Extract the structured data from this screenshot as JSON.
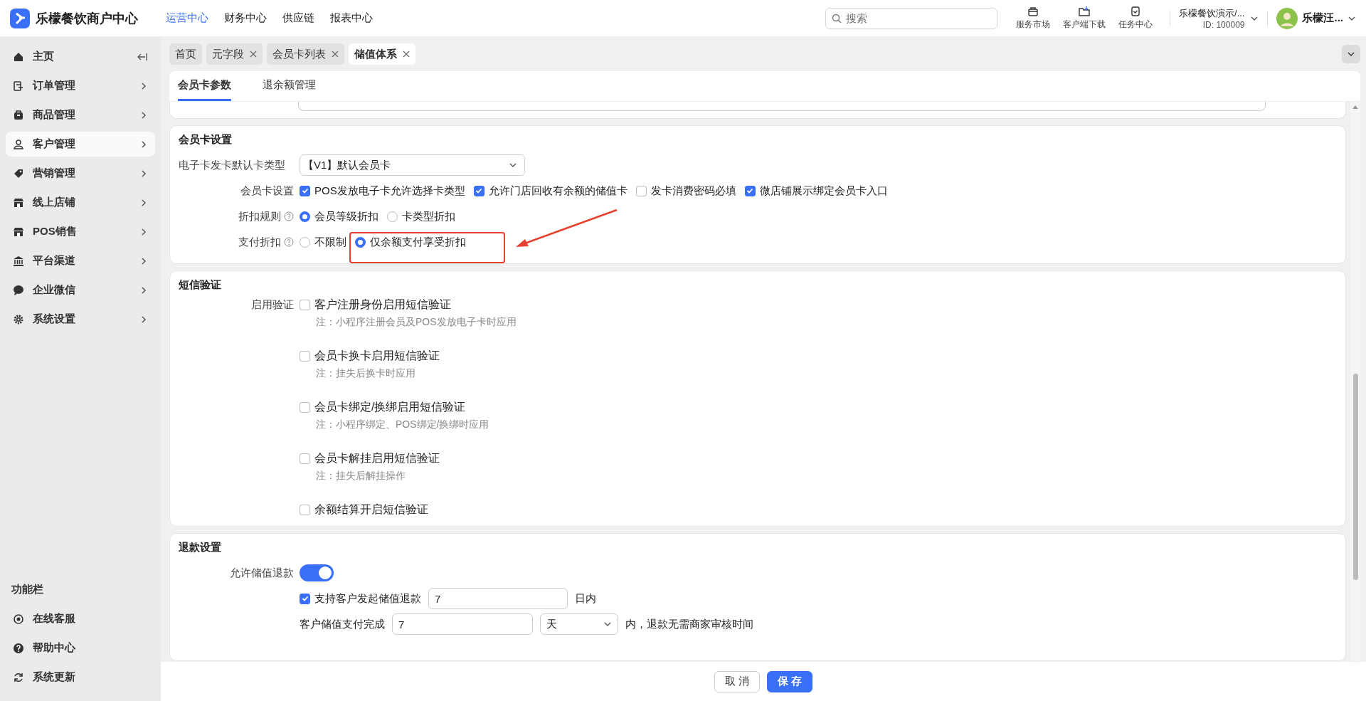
{
  "logo": {
    "name": "乐檬餐饮商户中心"
  },
  "top_nav": [
    {
      "label": "运营中心",
      "selected": true
    },
    {
      "label": "财务中心",
      "selected": false
    },
    {
      "label": "供应链",
      "selected": false
    },
    {
      "label": "报表中心",
      "selected": false
    }
  ],
  "search": {
    "placeholder": "搜索"
  },
  "tools": [
    {
      "label": "服务市场"
    },
    {
      "label": "客户端下载"
    },
    {
      "label": "任务中心"
    }
  ],
  "store": {
    "name": "乐檬餐饮演示/...",
    "id": "ID: 100009"
  },
  "user": {
    "name": "乐檬汪..."
  },
  "sidebar": {
    "items": [
      {
        "label": "主页",
        "selected": false
      },
      {
        "label": "订单管理",
        "selected": false
      },
      {
        "label": "商品管理",
        "selected": false
      },
      {
        "label": "客户管理",
        "selected": true
      },
      {
        "label": "营销管理",
        "selected": false
      },
      {
        "label": "线上店铺",
        "selected": false
      },
      {
        "label": "POS销售",
        "selected": false
      },
      {
        "label": "平台渠道",
        "selected": false
      },
      {
        "label": "企业微信",
        "selected": false
      },
      {
        "label": "系统设置",
        "selected": false
      }
    ],
    "footer_title": "功能栏",
    "footer_items": [
      {
        "label": "在线客服"
      },
      {
        "label": "帮助中心"
      },
      {
        "label": "系统更新"
      }
    ]
  },
  "page_tabs": [
    {
      "label": "首页",
      "closable": false,
      "selected": false
    },
    {
      "label": "元字段",
      "closable": true,
      "selected": false
    },
    {
      "label": "会员卡列表",
      "closable": true,
      "selected": false
    },
    {
      "label": "储值体系",
      "closable": true,
      "selected": true
    }
  ],
  "card_tabs": [
    {
      "label": "会员卡参数",
      "selected": true
    },
    {
      "label": "退余额管理",
      "selected": false
    }
  ],
  "member_card": {
    "title": "会员卡设置",
    "default_type": {
      "label": "电子卡发卡默认卡类型",
      "value": "【V1】默认会员卡"
    },
    "settings": {
      "label": "会员卡设置",
      "options": [
        {
          "label": "POS发放电子卡允许选择卡类型",
          "checked": true
        },
        {
          "label": "允许门店回收有余额的储值卡",
          "checked": true
        },
        {
          "label": "发卡消费密码必填",
          "checked": false
        },
        {
          "label": "微店铺展示绑定会员卡入口",
          "checked": true
        }
      ]
    },
    "discount_rule": {
      "label": "折扣规则",
      "options": [
        {
          "label": "会员等级折扣",
          "selected": true
        },
        {
          "label": "卡类型折扣",
          "selected": false
        }
      ]
    },
    "pay_discount": {
      "label": "支付折扣",
      "options": [
        {
          "label": "不限制",
          "selected": false
        },
        {
          "label": "仅余额支付享受折扣",
          "selected": true
        }
      ]
    }
  },
  "sms": {
    "title": "短信验证",
    "label": "启用验证",
    "options": [
      {
        "label": "客户注册身份启用短信验证",
        "checked": false,
        "note": "注：小程序注册会员及POS发放电子卡时应用"
      },
      {
        "label": "会员卡换卡启用短信验证",
        "checked": false,
        "note": "注：挂失后换卡时应用"
      },
      {
        "label": "会员卡绑定/换绑启用短信验证",
        "checked": false,
        "note": "注：小程序绑定、POS绑定/换绑时应用"
      },
      {
        "label": "会员卡解挂启用短信验证",
        "checked": false,
        "note": "注：挂失后解挂操作"
      },
      {
        "label": "余额结算开启短信验证",
        "checked": false
      }
    ]
  },
  "refund": {
    "title": "退款设置",
    "allow": {
      "label": "允许储值退款",
      "on": true
    },
    "customer_refund": {
      "label": "支持客户发起储值退款",
      "checked": true,
      "value": "7",
      "suffix": "日内"
    },
    "auto": {
      "label": "客户储值支付完成",
      "value": "7",
      "unit": "天",
      "suffix": "内，退款无需商家审核时间"
    }
  },
  "buttons": [
    {
      "label": "取 消",
      "kind": "default"
    },
    {
      "label": "保 存",
      "kind": "primary"
    }
  ]
}
